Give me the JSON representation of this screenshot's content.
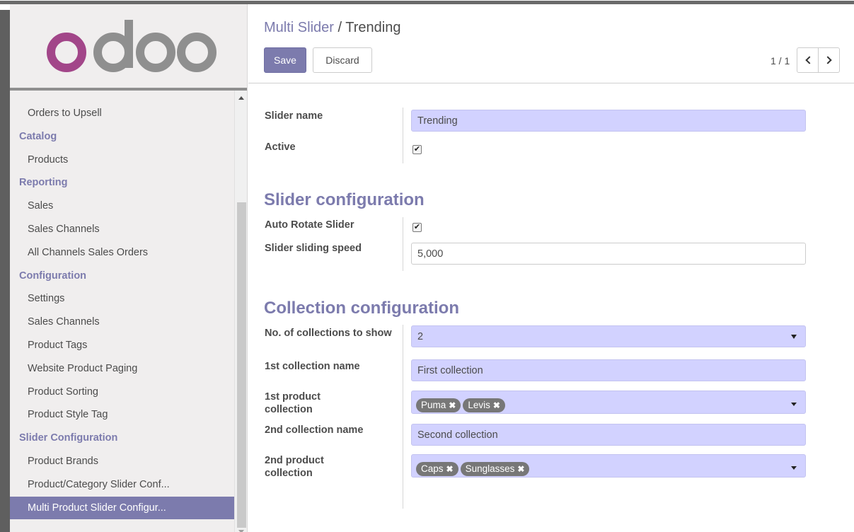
{
  "sidebar": {
    "logo_text": "odoo",
    "items": [
      {
        "label": "Orders to Upsell",
        "kind": "item"
      },
      {
        "label": "Catalog",
        "kind": "header"
      },
      {
        "label": "Products",
        "kind": "item"
      },
      {
        "label": "Reporting",
        "kind": "header"
      },
      {
        "label": "Sales",
        "kind": "item"
      },
      {
        "label": "Sales Channels",
        "kind": "item"
      },
      {
        "label": "All Channels Sales Orders",
        "kind": "item"
      },
      {
        "label": "Configuration",
        "kind": "header"
      },
      {
        "label": "Settings",
        "kind": "item"
      },
      {
        "label": "Sales Channels",
        "kind": "item"
      },
      {
        "label": "Product Tags",
        "kind": "item"
      },
      {
        "label": "Website Product Paging",
        "kind": "item"
      },
      {
        "label": "Product Sorting",
        "kind": "item"
      },
      {
        "label": "Product Style Tag",
        "kind": "item"
      },
      {
        "label": "Slider Configuration",
        "kind": "header"
      },
      {
        "label": "Product Brands",
        "kind": "item"
      },
      {
        "label": "Product/Category Slider Conf...",
        "kind": "item"
      },
      {
        "label": "Multi Product Slider Configur...",
        "kind": "item",
        "active": true
      }
    ]
  },
  "header": {
    "breadcrumb_parent": "Multi Slider",
    "breadcrumb_sep": "/",
    "breadcrumb_current": "Trending",
    "save_label": "Save",
    "discard_label": "Discard",
    "pager": "1 / 1"
  },
  "form": {
    "slider_name_label": "Slider name",
    "slider_name_value": "Trending",
    "active_label": "Active",
    "active_checked": true,
    "section_slider": "Slider configuration",
    "auto_rotate_label": "Auto Rotate Slider",
    "auto_rotate_checked": true,
    "speed_label": "Slider sliding speed",
    "speed_value": "5,000",
    "section_collection": "Collection configuration",
    "num_collections_label": "No. of collections to show",
    "num_collections_value": "2",
    "first_name_label": "1st collection name",
    "first_name_value": "First collection",
    "first_product_label": "1st product collection",
    "first_product_tags": [
      "Puma",
      "Levis"
    ],
    "second_name_label": "2nd collection name",
    "second_name_value": "Second collection",
    "second_product_label": "2nd product collection",
    "second_product_tags": [
      "Caps",
      "Sunglasses"
    ]
  },
  "colors": {
    "brand": "#7c7bad",
    "required_field": "#d2d2ff",
    "tag": "#777777"
  },
  "icons": {
    "checkbox_check": "check-icon",
    "tag_remove": "close-icon",
    "pager_prev": "chevron-left-icon",
    "pager_next": "chevron-right-icon"
  }
}
